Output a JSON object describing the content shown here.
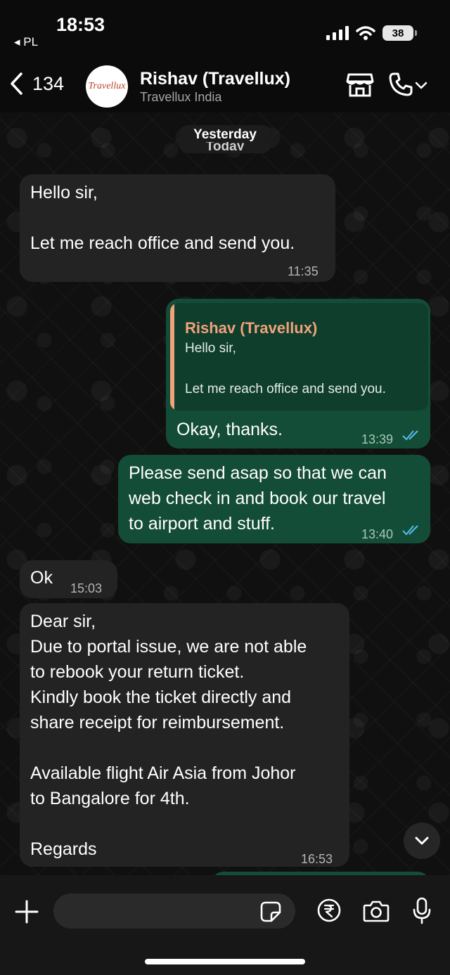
{
  "status_bar": {
    "time": "18:53",
    "back_app": "◂ PL",
    "battery": "38"
  },
  "header": {
    "back_count": "134",
    "avatar_logo_text": "Travellux",
    "contact_name": "Rishav (Travellux)",
    "contact_subtitle": "Travellux India"
  },
  "chat": {
    "date_label": "Yesterday",
    "date_label_behind": "Today",
    "messages": [
      {
        "direction": "in",
        "text": "Hello sir,\n\nLet me reach office and send you.",
        "time": "11:35"
      },
      {
        "direction": "out",
        "quote_author": "Rishav (Travellux)",
        "quote_text": "Hello sir,\n\nLet me reach office and send you.",
        "text": "Okay, thanks.",
        "time": "13:39",
        "status": "read"
      },
      {
        "direction": "out",
        "text": "Please send asap so that we can\nweb check in and book our travel\nto airport and stuff.",
        "time": "13:40",
        "status": "read"
      },
      {
        "direction": "in",
        "text": "Ok",
        "time": "15:03"
      },
      {
        "direction": "in",
        "text": "Dear sir,\nDue to portal issue, we are not able\nto rebook your return ticket.\nKindly book the ticket directly and\nshare receipt for reimbursement.\n\nAvailable flight Air Asia from Johor\nto Bangalore for 4th.\n\nRegards",
        "time": "16:53"
      }
    ]
  },
  "input": {
    "placeholder": ""
  },
  "colors": {
    "incoming_bubble": "#232323",
    "outgoing_bubble": "#144d37",
    "quote_accent": "#f0a27b",
    "read_ticks": "#53bdeb"
  },
  "icons": [
    "signal-icon",
    "wifi-icon",
    "chevron-left-icon",
    "shop-icon",
    "phone-icon",
    "chevron-down-icon",
    "double-check-icon",
    "plus-icon",
    "sticker-icon",
    "rupee-icon",
    "camera-icon",
    "microphone-icon"
  ]
}
